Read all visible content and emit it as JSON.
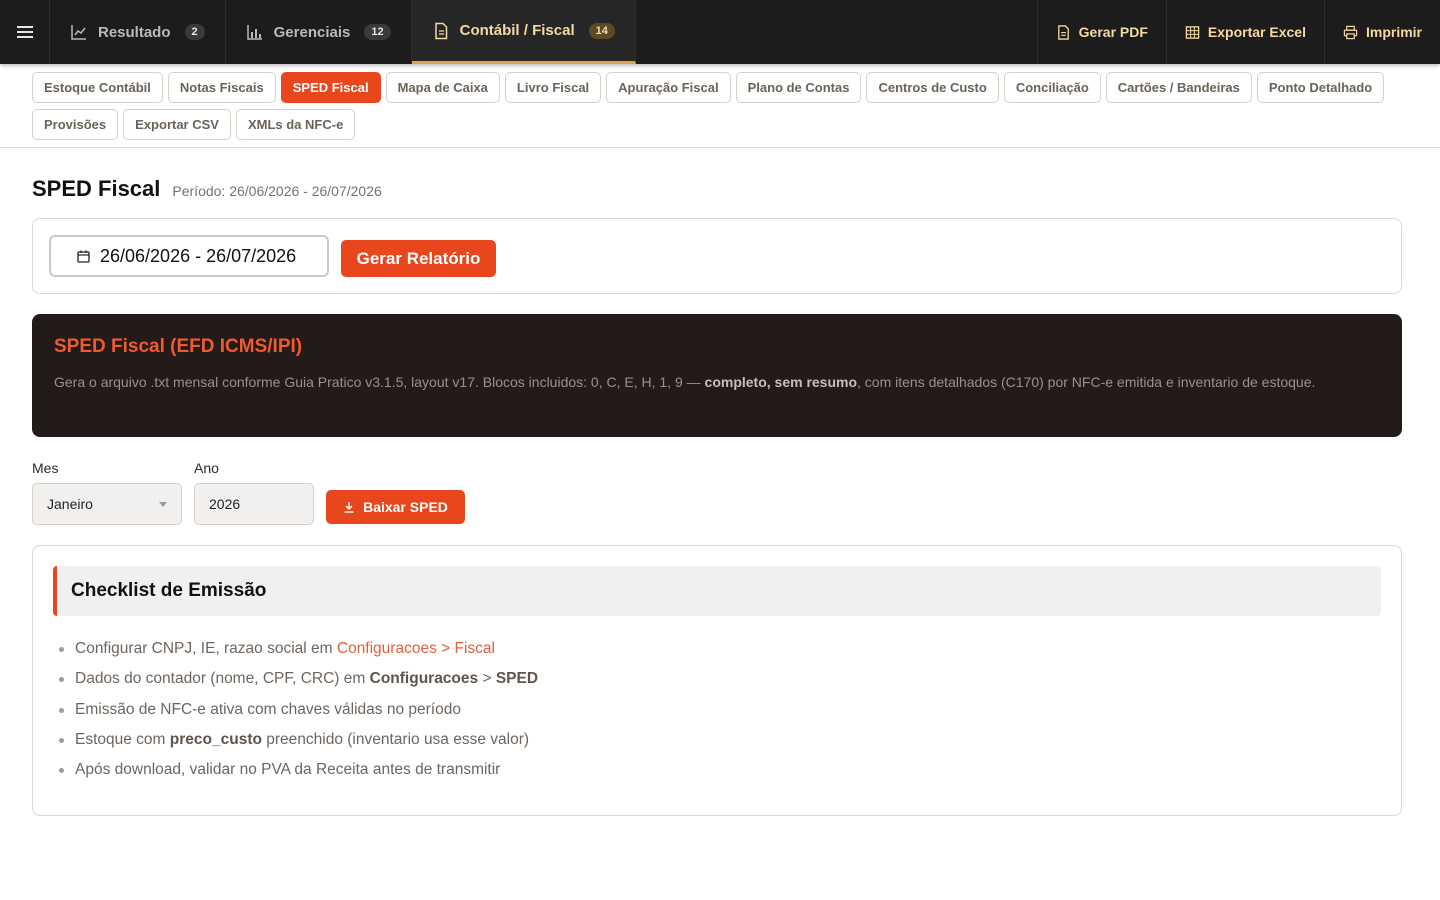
{
  "topbar": {
    "tabs": [
      {
        "label": "Resultado",
        "badge": "2"
      },
      {
        "label": "Gerenciais",
        "badge": "12"
      },
      {
        "label": "Contábil / Fiscal",
        "badge": "14"
      }
    ],
    "actions": {
      "pdf": "Gerar PDF",
      "excel": "Exportar Excel",
      "print": "Imprimir"
    }
  },
  "subnav": {
    "items": [
      "Estoque Contábil",
      "Notas Fiscais",
      "SPED Fiscal",
      "Mapa de Caixa",
      "Livro Fiscal",
      "Apuração Fiscal",
      "Plano de Contas",
      "Centros de Custo",
      "Conciliação",
      "Cartões / Bandeiras",
      "Ponto Detalhado",
      "Provisões",
      "Exportar CSV",
      "XMLs da NFC-e"
    ],
    "active": "SPED Fiscal"
  },
  "page": {
    "title": "SPED Fiscal",
    "period": "Período: 26/06/2026 - 26/07/2026"
  },
  "filter": {
    "date_range": "26/06/2026 - 26/07/2026",
    "generate_label": "Gerar Relatório"
  },
  "info": {
    "title": "SPED Fiscal (EFD ICMS/IPI)",
    "text_before": "Gera o arquivo .txt mensal conforme Guia Pratico v3.1.5, layout v17. Blocos incluidos: 0, C, E, H, 1, 9 — ",
    "text_bold": "completo, sem resumo",
    "text_after": ", com itens detalhados (C170) por NFC-e emitida e inventario de estoque."
  },
  "form": {
    "month_label": "Mes",
    "month_value": "Janeiro",
    "year_label": "Ano",
    "year_value": "2026",
    "download_label": "Baixar SPED"
  },
  "checklist": {
    "title": "Checklist de Emissão",
    "item1_pre": "Configurar CNPJ, IE, razao social em ",
    "item1_link": "Configuracoes > Fiscal",
    "item2_pre": "Dados do contador (nome, CPF, CRC) em ",
    "item2_bold1": "Configuracoes",
    "item2_sep": " > ",
    "item2_bold2": "SPED",
    "item3": "Emissão de NFC-e ativa com chaves válidas no período",
    "item4_pre": "Estoque com ",
    "item4_bold": "preco_custo",
    "item4_post": " preenchido (inventario usa esse valor)",
    "item5": "Após download, validar no PVA da Receita antes de transmitir"
  }
}
